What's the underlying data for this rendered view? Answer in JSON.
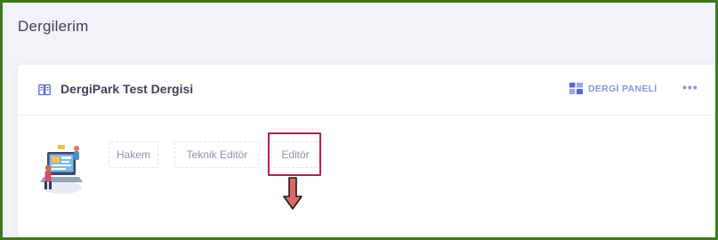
{
  "page": {
    "title": "Dergilerim"
  },
  "card": {
    "journal_name": "DergiPark Test Dergisi",
    "panel_button_label": "DERGİ PANELİ",
    "more_label": "•••",
    "roles": [
      {
        "label": "Hakem"
      },
      {
        "label": "Teknik Editör"
      },
      {
        "label": "Editör"
      }
    ]
  },
  "icons": {
    "journal": "book-open-icon",
    "panel": "grid-icon",
    "more": "more-horizontal-icon",
    "illustration": "editor-illustration",
    "annotation": "down-arrow-icon"
  },
  "colors": {
    "frame_border": "#3d7a1f",
    "frame_bg": "#d9ead3",
    "page_bg": "#f2f3f8",
    "accent": "#8b96d6",
    "highlight": "#b51f4d",
    "arrow_fill": "#e06666"
  }
}
